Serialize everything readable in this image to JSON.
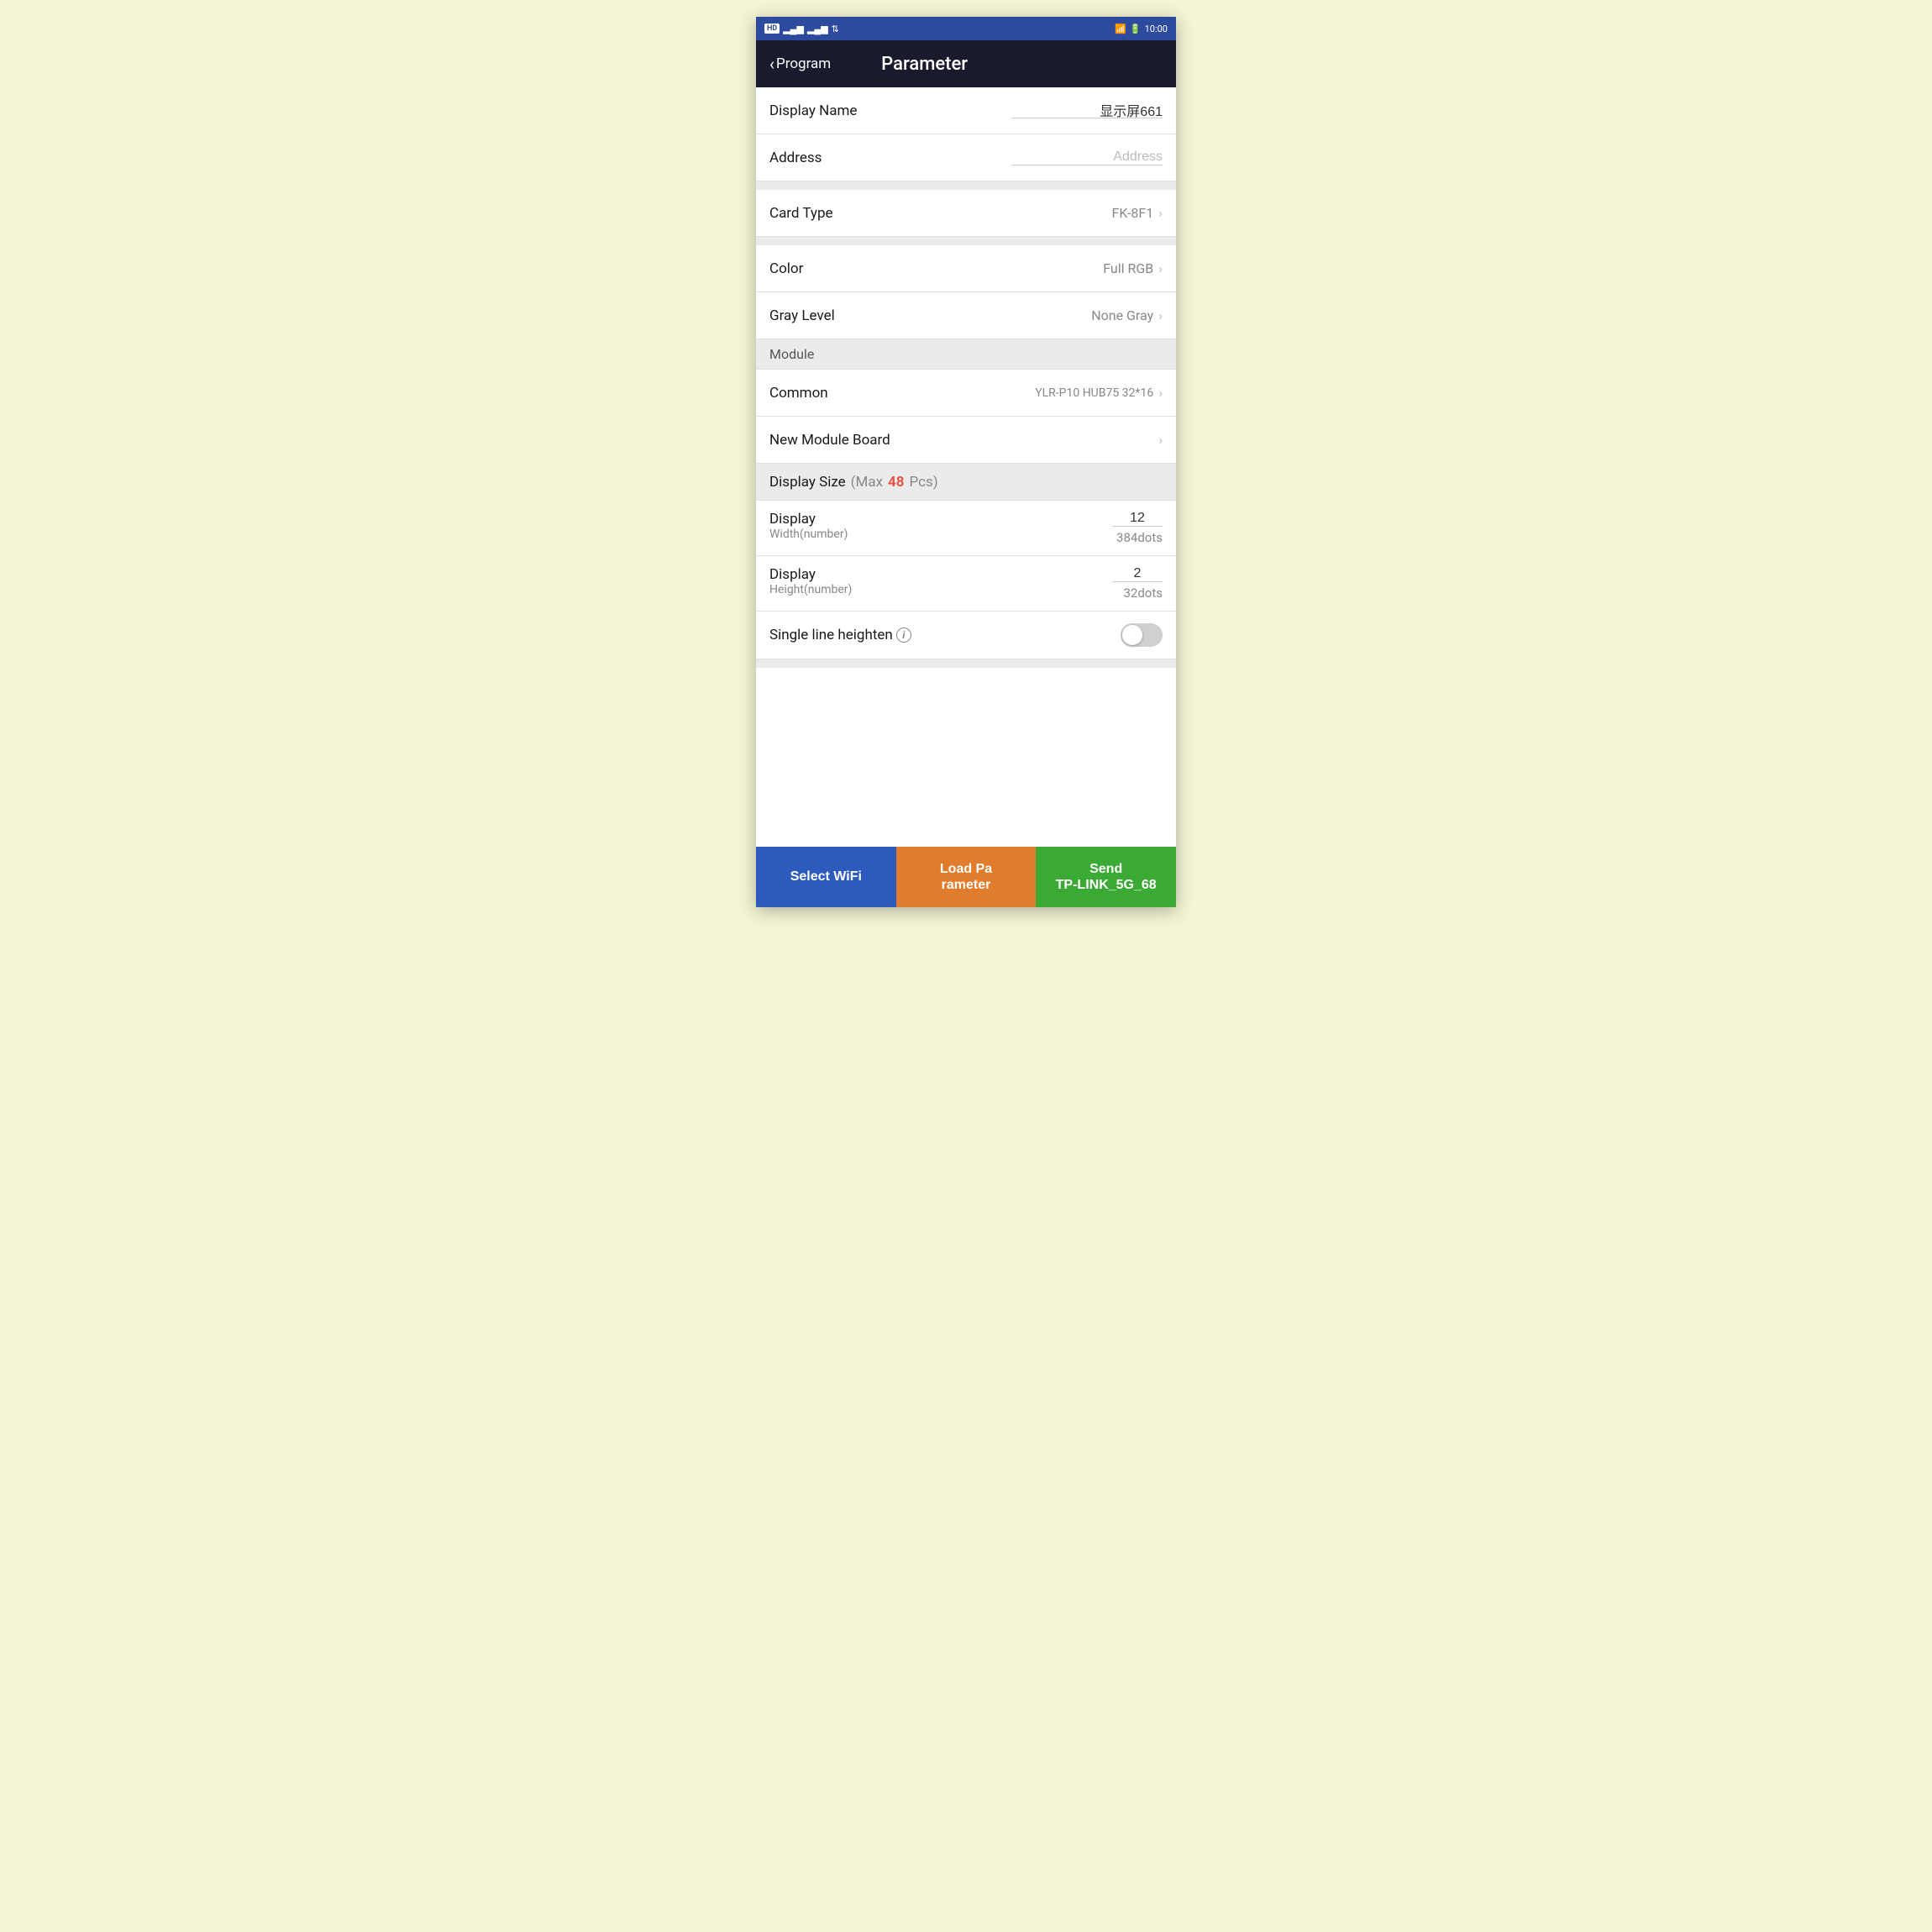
{
  "statusBar": {
    "left": "HD",
    "time": "10:00"
  },
  "navBar": {
    "backLabel": "Program",
    "title": "Parameter"
  },
  "fields": {
    "displayName": {
      "label": "Display Name",
      "value": "显示屏661"
    },
    "address": {
      "label": "Address",
      "placeholder": "Address"
    },
    "cardType": {
      "label": "Card Type",
      "value": "FK-8F1"
    },
    "color": {
      "label": "Color",
      "value": "Full RGB"
    },
    "grayLevel": {
      "label": "Gray Level",
      "value": "None Gray"
    },
    "moduleSection": {
      "label": "Module"
    },
    "common": {
      "label": "Common",
      "value": "YLR-P10 HUB75 32*16"
    },
    "newModuleBoard": {
      "label": "New Module Board"
    },
    "displaySize": {
      "label": "Display Size",
      "maxLabel": "(Max",
      "maxNumber": "48",
      "pcsLabel": "Pcs)"
    },
    "displayWidth": {
      "label": "Display",
      "sublabel": "Width(number)",
      "value": "12",
      "dots": "384dots"
    },
    "displayHeight": {
      "label": "Display",
      "sublabel": "Height(number)",
      "value": "2",
      "dots": "32dots"
    },
    "singleLine": {
      "label": "Single line heighten"
    }
  },
  "bottomBar": {
    "wifi": "Select WiFi",
    "load": "Load Pa\nrameter",
    "send": "Send\nTP-LINK_5G_68"
  }
}
